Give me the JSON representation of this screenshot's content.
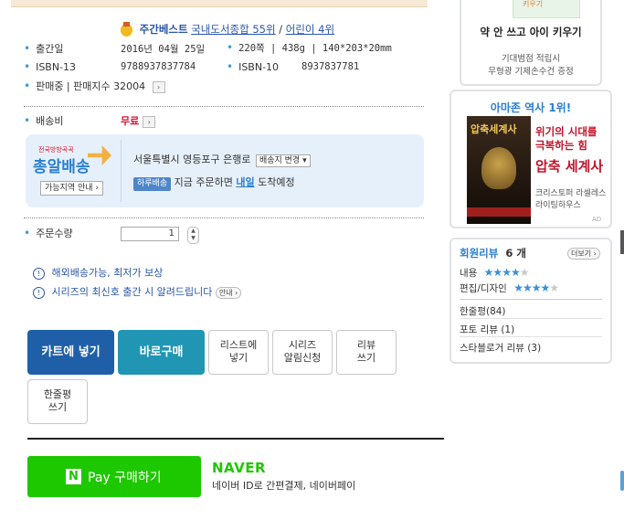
{
  "bestseller": {
    "label": "주간베스트",
    "rank1": "국내도서종합 55위",
    "sep": "/",
    "rank2": "어린이 4위"
  },
  "info": [
    {
      "label": "출간일",
      "value": "2016년 04월 25일",
      "label2": "",
      "value2": "220쪽 | 438g | 140*203*20mm"
    },
    {
      "label": "ISBN-13",
      "value": "9788937837784",
      "label2": "ISBN-10",
      "value2": "8937837781"
    }
  ],
  "sales": {
    "label": "판매중 | 판매지수 32004"
  },
  "shipping": {
    "label": "배송비",
    "value": "무료",
    "logo_top": "전국방방곡곡",
    "logo_main": "총알배송",
    "logo_link": "가능지역 안내",
    "address": "서울특별시 영등포구 은행로",
    "change_btn": "배송지 변경",
    "badge": "하루배송",
    "msg_pre": "지금 주문하면",
    "msg_day": "내일",
    "msg_post": "도착예정"
  },
  "quantity": {
    "label": "주문수량",
    "value": "1"
  },
  "notices": [
    {
      "text": "해외배송가능, 최저가 보상"
    },
    {
      "text": "시리즈의 최신호 출간 시 알려드립니다",
      "button": "안내"
    }
  ],
  "buttons": {
    "cart": "카트에 넣기",
    "buy": "바로구매",
    "list": [
      "리스트에",
      "넣기"
    ],
    "series": [
      "시리즈",
      "알림신청"
    ],
    "review": [
      "리뷰",
      "쓰기"
    ],
    "oneline": [
      "한줄평",
      "쓰기"
    ]
  },
  "naverpay": {
    "label": "Pay 구매하기",
    "logo": "NAVER",
    "desc": "네이버 ID로 간편결제, 네이버페이"
  },
  "sidebar": {
    "ad1_banner": "키우기",
    "ad1_title": "약 안 쓰고 아이 키우기",
    "ad1_desc1": "기대범점 적립시",
    "ad1_desc2": "무형광 기제손수건 증정",
    "ad2_head": "아마존 역사 1위!",
    "ad2_cover": "압축세계사",
    "ad2_line1": "위기의 시대를",
    "ad2_line2": "극복하는 힘",
    "ad2_title": "압축 세계사",
    "ad2_author": "크리스토퍼 라셀레스",
    "ad2_pub": "라이팅하우스",
    "ad2_tag": "AD"
  },
  "reviews": {
    "title": "회원리뷰",
    "count": "6 개",
    "more": "더보기",
    "content_label": "내용",
    "content_stars": 4,
    "design_label": "편집/디자인",
    "design_stars": 4,
    "items": [
      "한줄평(84)",
      "포토 리뷰 (1)",
      "스타블로거 리뷰 (3)"
    ]
  },
  "colors": {
    "accent": "#1f5fa8",
    "buy": "#2096b4",
    "naver": "#1ec800",
    "price_red": "#d8132b"
  }
}
